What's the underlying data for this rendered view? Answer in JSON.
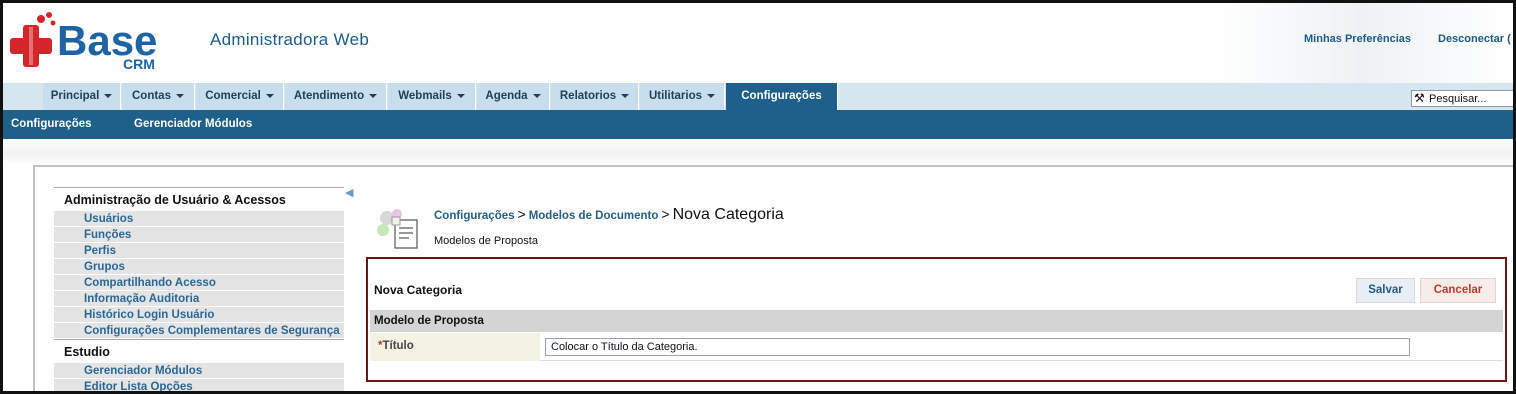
{
  "header": {
    "logo_text": "Base",
    "logo_sub": "CRM",
    "app_title": "Administradora Web",
    "links": [
      "Minhas Preferências",
      "Desconectar ("
    ]
  },
  "nav": {
    "tabs": [
      {
        "label": "Principal",
        "dropdown": true
      },
      {
        "label": "Contas",
        "dropdown": true
      },
      {
        "label": "Comercial",
        "dropdown": true
      },
      {
        "label": "Atendimento",
        "dropdown": true
      },
      {
        "label": "Webmails",
        "dropdown": true
      },
      {
        "label": "Agenda",
        "dropdown": true
      },
      {
        "label": "Relatorios",
        "dropdown": true
      },
      {
        "label": "Utilitarios",
        "dropdown": true
      },
      {
        "label": "Configurações",
        "dropdown": false,
        "active": true
      }
    ],
    "search_value": "Pesquisar..."
  },
  "subnav": {
    "items": [
      "Configurações",
      "Gerenciador Módulos"
    ]
  },
  "sidebar": {
    "sections": [
      {
        "heading": "Administração de Usuário & Acessos",
        "items": [
          "Usuários",
          "Funções",
          "Perfis",
          "Grupos",
          "Compartilhando Acesso",
          "Informação Auditoria",
          "Histórico Login Usuário",
          "Configurações Complementares de Segurança"
        ]
      },
      {
        "heading": "Estudio",
        "items": [
          "Gerenciador Módulos",
          "Editor Lista Opções"
        ]
      }
    ]
  },
  "breadcrumb": {
    "parts": [
      "Configurações",
      "Modelos de Documento"
    ],
    "separator": ">",
    "current": "Nova Categoria"
  },
  "subtitle": "Modelos de Proposta",
  "form": {
    "title": "Nova Categoria",
    "save_label": "Salvar",
    "cancel_label": "Cancelar",
    "section": "Modelo de Proposta",
    "required_mark": "*",
    "field_label": "Título",
    "field_value": "Colocar o Título da Categoria."
  },
  "colors": {
    "nav_active": "#1e5f8c",
    "subnav_bg": "#1f6089",
    "panel_border": "#6e1414",
    "link": "#245f8a"
  }
}
